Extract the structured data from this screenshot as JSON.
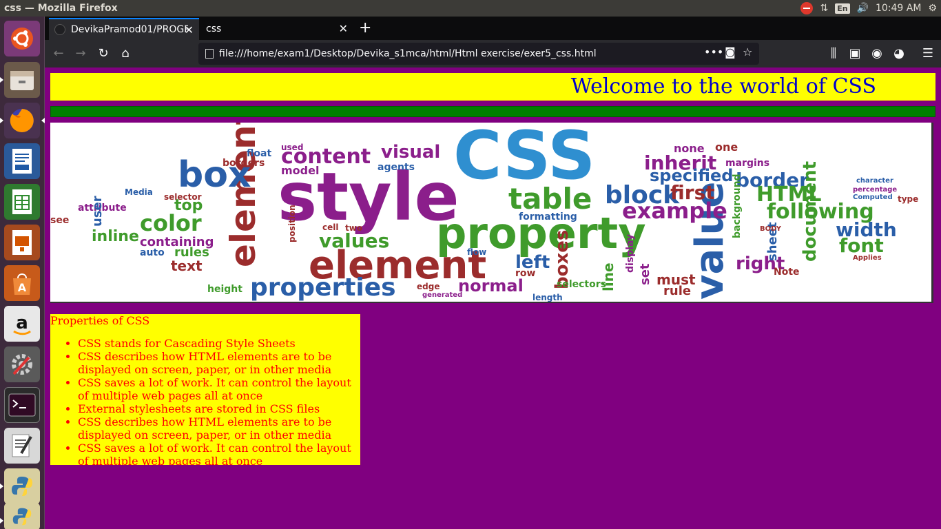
{
  "window": {
    "title": "css — Mozilla Firefox"
  },
  "tray": {
    "lang": "En",
    "clock": "10:49 AM"
  },
  "launcher": [
    "ubuntu-dash",
    "files",
    "firefox",
    "writer",
    "calc",
    "impress",
    "software-center",
    "amazon",
    "settings",
    "terminal",
    "text-editor",
    "python",
    "python"
  ],
  "tabs": [
    {
      "title": "DevikaPramod01/PROGR"
    },
    {
      "title": "css"
    }
  ],
  "url": "file:///home/exam1/Desktop/Devika_s1mca/html/Html exercise/exer5_css.html",
  "page": {
    "heading": "Welcome to the world of CSS",
    "colors": {
      "background": "#800080",
      "header_bg": "#ffff00",
      "heading_color": "#0000cd",
      "bar": "#008000",
      "list_text": "#ff0000"
    },
    "wordcloud": {
      "words": [
        "CSS",
        "style",
        "property",
        "element",
        "elements",
        "box",
        "table",
        "block",
        "value",
        "values",
        "content",
        "visual",
        "inherit",
        "border",
        "HTML",
        "example",
        "following",
        "width",
        "font",
        "color",
        "properties",
        "normal",
        "left",
        "right",
        "first",
        "boxes",
        "specified",
        "top",
        "inline",
        "containing",
        "rules",
        "text",
        "must",
        "rule",
        "document",
        "none",
        "one",
        "margins",
        "formatting",
        "selectors",
        "row",
        "height",
        "Note",
        "float",
        "borders",
        "model",
        "agents",
        "used",
        "auto",
        "attribute",
        "see",
        "position",
        "length",
        "edge",
        "generated",
        "two",
        "cell",
        "flow",
        "line",
        "set",
        "display",
        "sheet",
        "background",
        "type",
        "percentage",
        "Computed",
        "character",
        "BODY",
        "Applies",
        "user",
        "selector",
        "Media"
      ]
    },
    "props": {
      "title": "Properties of CSS",
      "items": [
        "CSS stands for Cascading Style Sheets",
        "CSS describes how HTML elements are to be displayed on screen, paper, or in other media",
        "CSS saves a lot of work. It can control the layout of multiple web pages all at once",
        "External stylesheets are stored in CSS files",
        "CSS describes how HTML elements are to be displayed on screen, paper, or in other media",
        "CSS saves a lot of work. It can control the layout of multiple web pages all at once"
      ]
    }
  }
}
